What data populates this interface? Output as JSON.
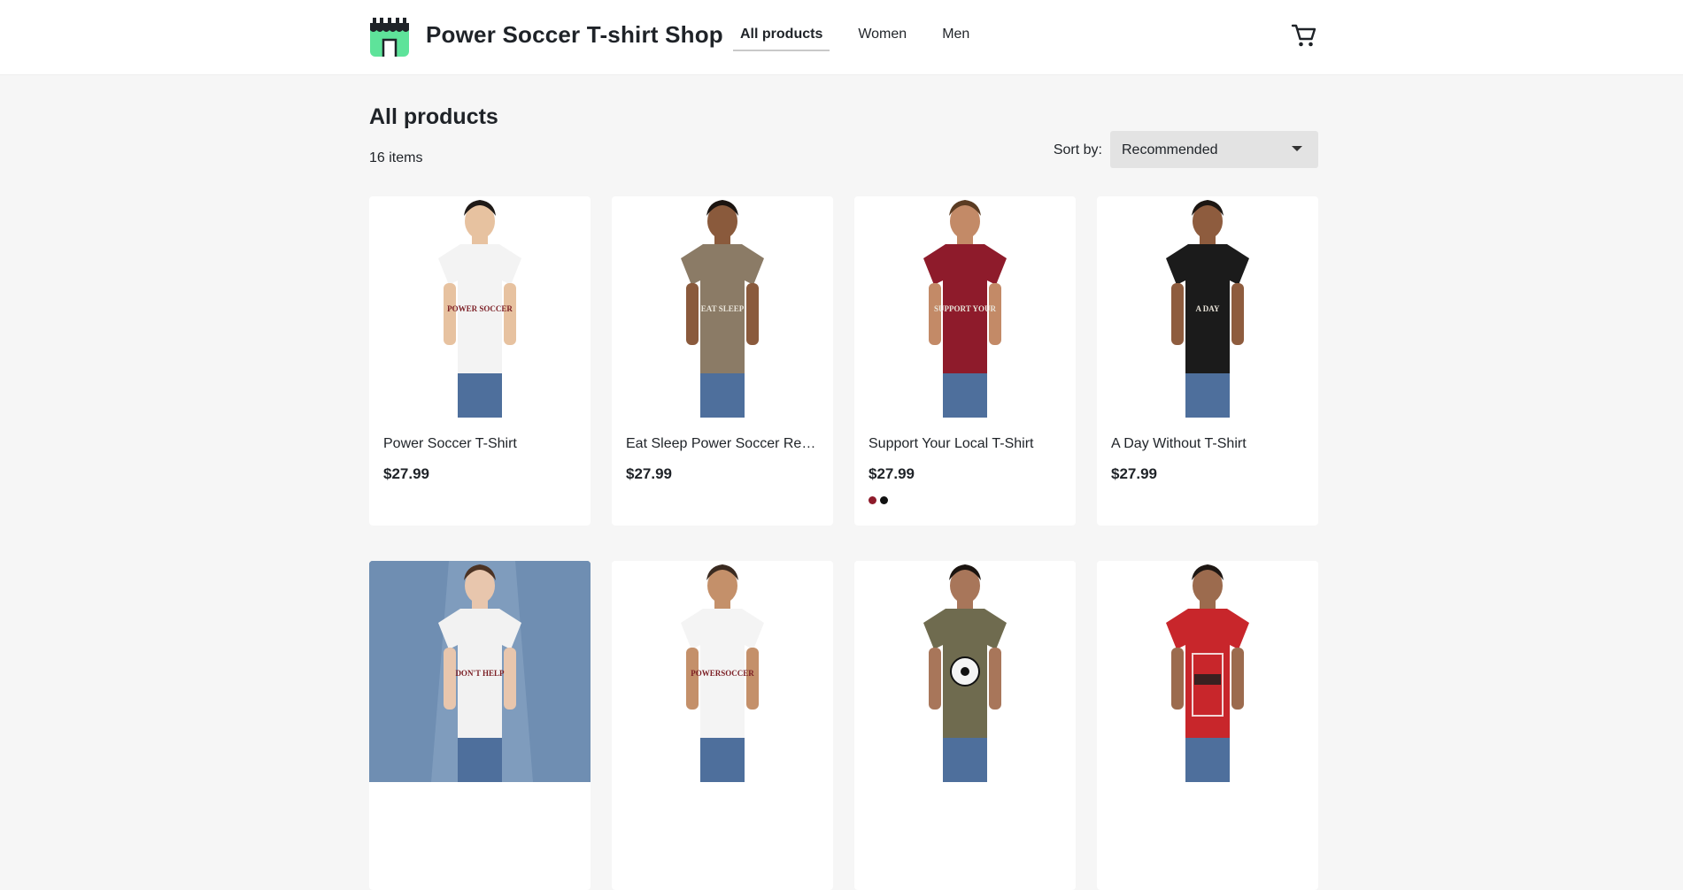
{
  "header": {
    "shop_title": "Power Soccer T-shirt Shop",
    "logo_icon": "storefront-icon",
    "nav": [
      {
        "label": "All products",
        "active": true
      },
      {
        "label": "Women",
        "active": false
      },
      {
        "label": "Men",
        "active": false
      }
    ],
    "cart_icon": "shopping-cart-icon",
    "brand_color": "#5ee39a"
  },
  "main": {
    "title": "All products",
    "item_count": "16 items",
    "sort_label": "Sort by:",
    "sort_value": "Recommended"
  },
  "products": [
    {
      "name": "Power Soccer T-Shirt",
      "price": "$27.99",
      "shirt_color": "#f3f3f3",
      "print_text": "POWER SOCCER",
      "swatches": []
    },
    {
      "name": "Eat Sleep Power Soccer Repeat T-Shirt",
      "price": "$27.99",
      "shirt_color": "#8b7b66",
      "print_text": "EAT SLEEP POWER SOCCER REPEAT",
      "swatches": []
    },
    {
      "name": "Support Your Local T-Shirt",
      "price": "$27.99",
      "shirt_color": "#8e1b2b",
      "print_text": "SUPPORT YOUR LOCAL",
      "swatches": [
        "#8e1b2b",
        "#111111"
      ]
    },
    {
      "name": "A Day Without T-Shirt",
      "price": "$27.99",
      "shirt_color": "#1b1b1b",
      "print_text": "A DAY WITHOUT",
      "swatches": []
    },
    {
      "name": "",
      "price": "",
      "shirt_color": "#f2f2f2",
      "print_text": "DON'T HELP ME",
      "swatches": []
    },
    {
      "name": "",
      "price": "",
      "shirt_color": "#f4f4f4",
      "print_text": "POWERSOCCER",
      "swatches": []
    },
    {
      "name": "",
      "price": "",
      "shirt_color": "#6f6b4f",
      "print_text": "",
      "swatches": []
    },
    {
      "name": "",
      "price": "",
      "shirt_color": "#c8262b",
      "print_text": "",
      "swatches": []
    }
  ]
}
